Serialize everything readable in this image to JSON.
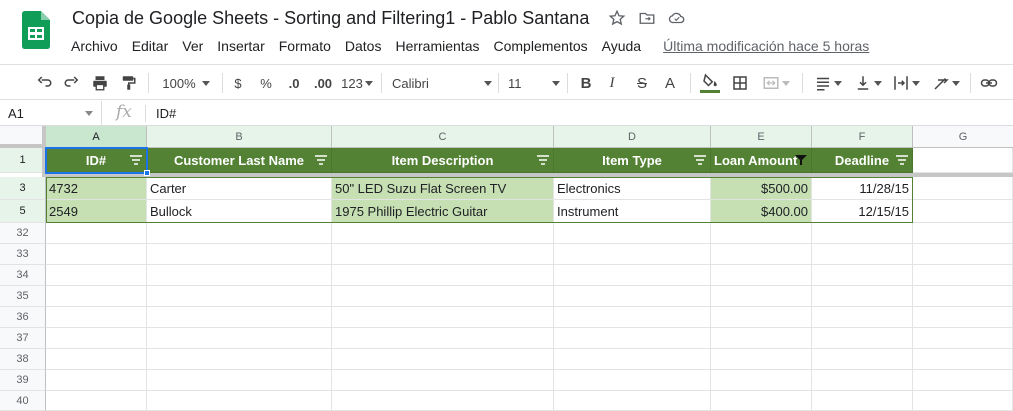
{
  "document": {
    "title": "Copia de Google Sheets - Sorting and Filtering1 - Pablo Santana"
  },
  "menu": [
    "Archivo",
    "Editar",
    "Ver",
    "Insertar",
    "Formato",
    "Datos",
    "Herramientas",
    "Complementos",
    "Ayuda"
  ],
  "last_modified": "Última modificación hace 5 horas",
  "toolbar": {
    "zoom": "100%",
    "currency": "$",
    "percent": "%",
    "dec_decrease": ".0",
    "dec_increase": ".00",
    "more_formats": "123",
    "font": "Calibri",
    "font_size": "11",
    "bold": "B",
    "italic": "I",
    "strike": "S",
    "text_color": "A"
  },
  "formula_bar": {
    "cell_ref": "A1",
    "fx": "fx",
    "value": "ID#"
  },
  "columns": [
    "A",
    "B",
    "C",
    "D",
    "E",
    "F",
    "G"
  ],
  "rows": [
    "1",
    "3",
    "5",
    "32",
    "33",
    "34",
    "35",
    "36",
    "37",
    "38",
    "39",
    "40"
  ],
  "table": {
    "headers": [
      "ID#",
      "Customer Last Name",
      "Item Description",
      "Item Type",
      "Loan Amount",
      "Deadline"
    ],
    "data": [
      [
        "4732",
        "Carter",
        "50\" LED Suzu Flat Screen TV",
        "Electronics",
        "$500.00",
        "11/28/15"
      ],
      [
        "2549",
        "Bullock",
        "1975 Phillip Electric Guitar",
        "Instrument",
        "$400.00",
        "12/15/15"
      ]
    ]
  },
  "colors": {
    "header_fill": "#548235",
    "band_fill": "#c6e0b4",
    "selection": "#1a73e8",
    "logo_green": "#0f9d58"
  }
}
